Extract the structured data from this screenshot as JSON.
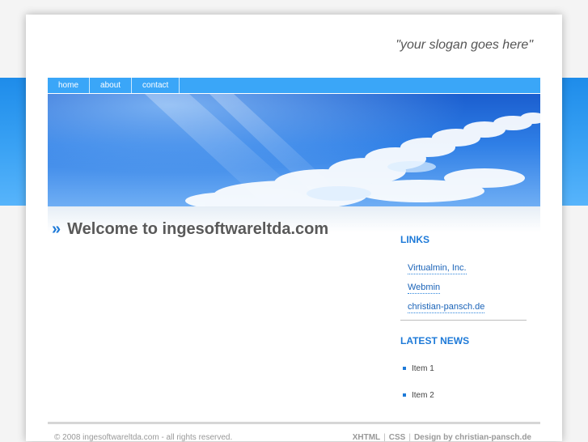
{
  "header": {
    "slogan": "\"your slogan goes here\""
  },
  "nav": {
    "items": [
      {
        "label": "home"
      },
      {
        "label": "about"
      },
      {
        "label": "contact"
      }
    ]
  },
  "main": {
    "raquo": "»",
    "title": "Welcome to ingesoftwareltda.com"
  },
  "sidebar": {
    "links_heading": "LINKS",
    "links": [
      {
        "label": "Virtualmin, Inc."
      },
      {
        "label": "Webmin"
      },
      {
        "label": "christian-pansch.de"
      }
    ],
    "news_heading": "LATEST NEWS",
    "news": [
      {
        "label": "Item 1"
      },
      {
        "label": "Item 2"
      }
    ]
  },
  "footer": {
    "copyright": "© 2008 ingesoftwareltda.com - all rights reserved.",
    "xhtml": "XHTML",
    "css": "CSS",
    "separator": "|",
    "credit": "Design by christian-pansch.de"
  },
  "colors": {
    "accent": "#1e7ad8",
    "nav_bg": "#3aa6f8",
    "band": "#2f98f0"
  }
}
